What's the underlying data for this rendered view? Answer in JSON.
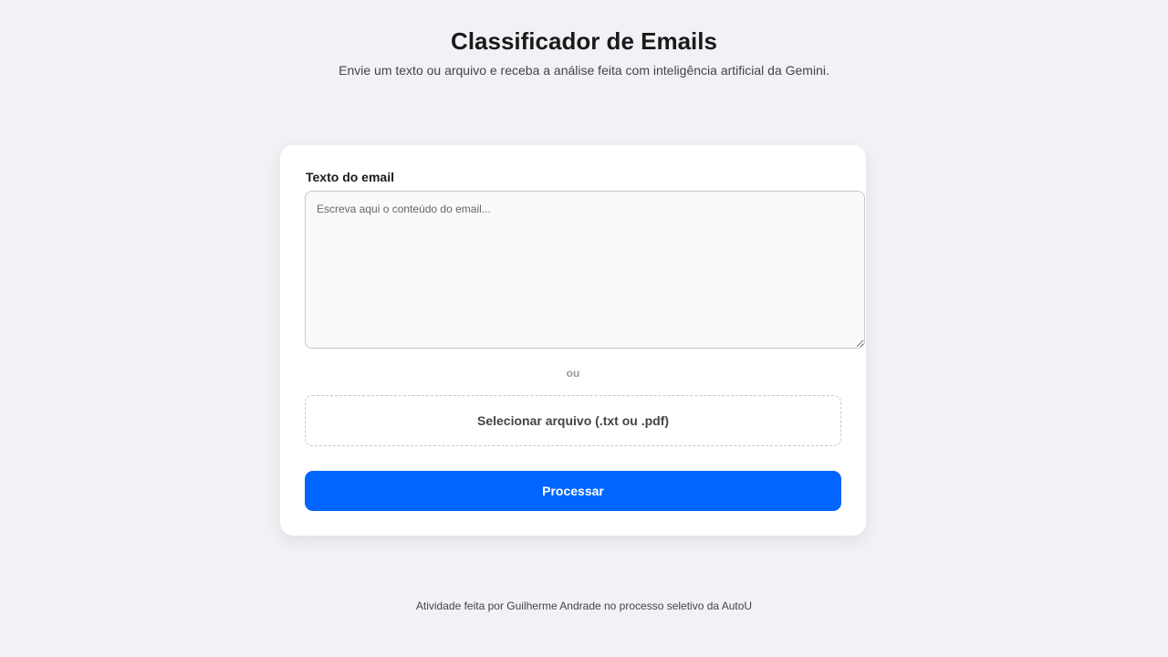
{
  "header": {
    "title": "Classificador de Emails",
    "subtitle": "Envie um texto ou arquivo e receba a análise feita com inteligência artificial da Gemini."
  },
  "form": {
    "email_label": "Texto do email",
    "email_placeholder": "Escreva aqui o conteúdo do email...",
    "email_value": "",
    "divider": "ou",
    "file_button_label": "Selecionar arquivo (.txt ou .pdf)",
    "submit_label": "Processar"
  },
  "footer": {
    "text": "Atividade feita por Guilherme Andrade no processo seletivo da AutoU"
  },
  "colors": {
    "background": "#f0f2f5",
    "card": "#ffffff",
    "accent": "#0066ff"
  }
}
